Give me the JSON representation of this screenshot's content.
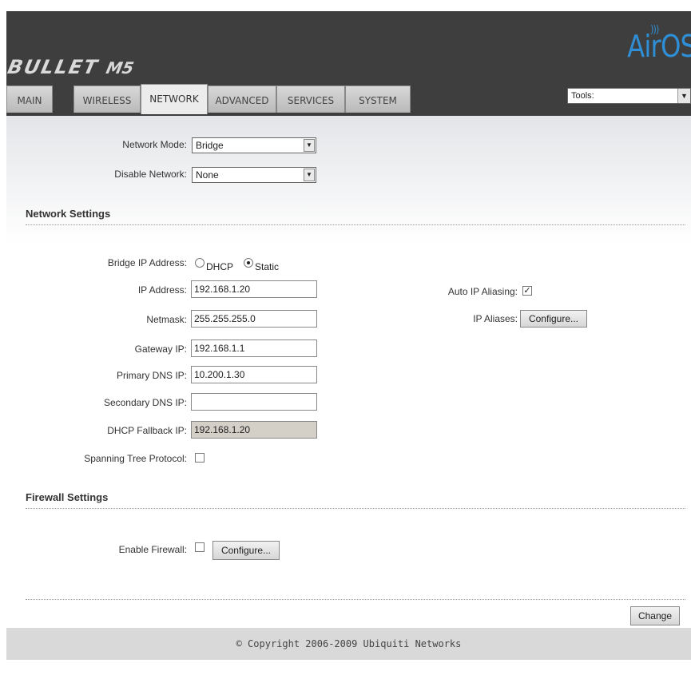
{
  "header": {
    "brand": "BULLET",
    "brand_model": "M5",
    "logo": "AirOS",
    "logo_icon": "wifi-icon"
  },
  "tabs": [
    {
      "label": "MAIN"
    },
    {
      "label": "WIRELESS"
    },
    {
      "label": "NETWORK"
    },
    {
      "label": "ADVANCED"
    },
    {
      "label": "SERVICES"
    },
    {
      "label": "SYSTEM"
    }
  ],
  "tools": {
    "label": "Tools:"
  },
  "mode": {
    "network_mode_label": "Network Mode:",
    "network_mode_value": "Bridge",
    "disable_network_label": "Disable Network:",
    "disable_network_value": "None"
  },
  "network_settings": {
    "title": "Network Settings",
    "bridge_ip_label": "Bridge IP Address:",
    "dhcp_label": "DHCP",
    "static_label": "Static",
    "ip_label": "IP Address:",
    "ip_value": "192.168.1.20",
    "netmask_label": "Netmask:",
    "netmask_value": "255.255.255.0",
    "gateway_label": "Gateway IP:",
    "gateway_value": "192.168.1.1",
    "primary_dns_label": "Primary DNS IP:",
    "primary_dns_value": "10.200.1.30",
    "secondary_dns_label": "Secondary DNS IP:",
    "secondary_dns_value": "",
    "fallback_label": "DHCP Fallback IP:",
    "fallback_value": "192.168.1.20",
    "stp_label": "Spanning Tree Protocol:",
    "auto_alias_label": "Auto IP Aliasing:",
    "ip_aliases_label": "IP Aliases:",
    "configure_label": "Configure..."
  },
  "firewall": {
    "title": "Firewall Settings",
    "enable_label": "Enable Firewall:",
    "configure_label": "Configure..."
  },
  "actions": {
    "change_label": "Change"
  },
  "footer": {
    "copyright": "© Copyright 2006-2009 Ubiquiti Networks"
  }
}
